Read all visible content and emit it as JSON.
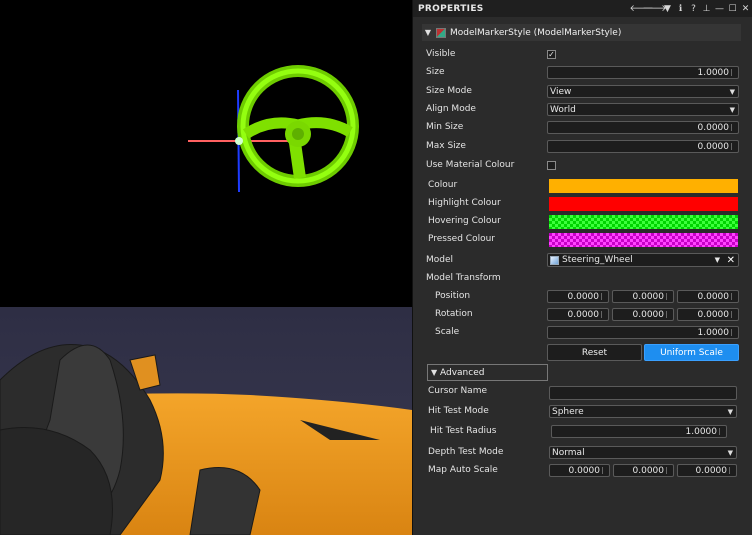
{
  "panel": {
    "title": "PROPERTIES",
    "header_icons": [
      "arrow-left-icon",
      "arrow-right-icon",
      "dropdown-icon",
      "info-icon",
      "help-icon",
      "pin-icon",
      "minimize-icon",
      "maximize-icon",
      "close-icon"
    ],
    "header_glyphs": [
      "🡐",
      "🡒",
      "▼",
      "ℹ",
      "?",
      "⊥",
      "—",
      "☐",
      "✕"
    ]
  },
  "component": {
    "title": "ModelMarkerStyle (ModelMarkerStyle)"
  },
  "fields": {
    "visible": {
      "label": "Visible",
      "checked": true,
      "mark": "✓"
    },
    "size": {
      "label": "Size",
      "value": "1.0000"
    },
    "size_mode": {
      "label": "Size Mode",
      "value": "View"
    },
    "align_mode": {
      "label": "Align Mode",
      "value": "World"
    },
    "min_size": {
      "label": "Min Size",
      "value": "0.0000"
    },
    "max_size": {
      "label": "Max Size",
      "value": "0.0000"
    },
    "use_material_colour": {
      "label": "Use Material Colour",
      "checked": false
    },
    "colour": {
      "label": "Colour",
      "color": "#ffb000"
    },
    "highlight_colour": {
      "label": "Highlight Colour",
      "color": "#ff0000"
    },
    "hovering_colour": {
      "label": "Hovering Colour",
      "color": "#00e000"
    },
    "pressed_colour": {
      "label": "Pressed Colour",
      "color": "#e000e0"
    },
    "model": {
      "label": "Model",
      "value": "Steering_Wheel"
    },
    "model_transform": {
      "label": "Model Transform"
    },
    "position": {
      "label": "Position",
      "x": "0.0000",
      "y": "0.0000",
      "z": "0.0000"
    },
    "rotation": {
      "label": "Rotation",
      "x": "0.0000",
      "y": "0.0000",
      "z": "0.0000"
    },
    "scale": {
      "label": "Scale",
      "value": "1.0000"
    },
    "reset_label": "Reset",
    "uniform_scale_label": "Uniform Scale"
  },
  "advanced": {
    "label": "Advanced",
    "cursor_name": {
      "label": "Cursor Name",
      "value": ""
    },
    "hit_test_mode": {
      "label": "Hit Test Mode",
      "value": "Sphere"
    },
    "hit_test_radius": {
      "label": "Hit Test Radius",
      "value": "1.0000"
    },
    "depth_test_mode": {
      "label": "Depth Test Mode",
      "value": "Normal"
    },
    "map_auto_scale": {
      "label": "Map Auto Scale",
      "x": "0.0000",
      "y": "0.0000",
      "z": "0.0000"
    }
  },
  "colors": {
    "accent": "#1e8ef0",
    "wheel_green": "#7fe000",
    "car_orange": "#f0a020"
  }
}
